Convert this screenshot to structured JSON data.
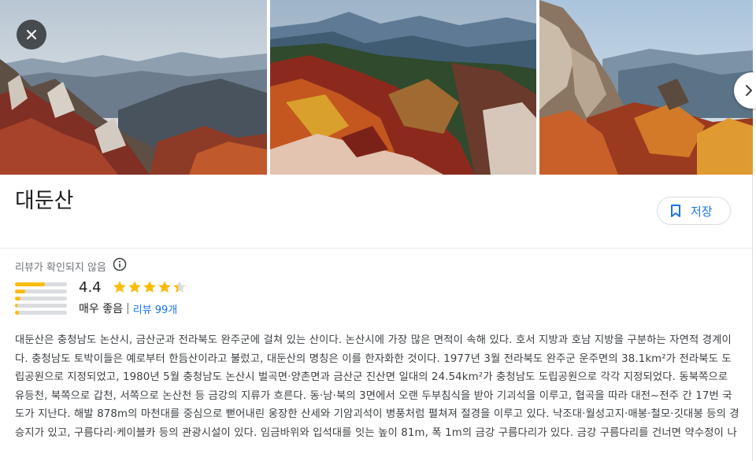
{
  "place": {
    "title": "대둔산",
    "save_label": "저장"
  },
  "photos": [
    {
      "icon": "mountain-mist-photo"
    },
    {
      "icon": "autumn-ridge-photo"
    },
    {
      "icon": "rocky-peak-photo"
    }
  ],
  "controls": {
    "close_icon": "close-icon",
    "next_icon": "chevron-right-icon",
    "save_icon": "bookmark-icon"
  },
  "rating": {
    "unverified_label": "리뷰가 확인되지 않음",
    "score": "4.4",
    "score_value": 4.4,
    "word": "매우 좋음",
    "separator": "|",
    "reviews_link": "리뷰 99개",
    "distribution": [
      0.58,
      0.2,
      0.1,
      0.05,
      0.08
    ]
  },
  "description": "대둔산은 충청남도 논산시, 금산군과 전라북도 완주군에 걸쳐 있는 산이다. 논산시에 가장 많은 면적이 속해 있다. 호서 지방과 호남 지방을 구분하는 자연적 경계이다. 충청남도 토박이들은 예로부터 한듬산이라고 불렀고, 대둔산의 명칭은 이를 한자화한 것이다. 1977년 3월 전라북도 완주군 운주면의 38.1km²가 전라북도 도립공원으로 지정되었고, 1980년 5월 충청남도 논산시 벌곡면·양촌면과 금산군 진산면 일대의 24.54km²가 충청남도 도립공원으로 각각 지정되었다. 동북쪽으로 유등천, 북쪽으로 갑천, 서쪽으로 논산천 등 금강의 지류가 흐른다. 동·남·북의 3면에서 오랜 두부침식을 받아 기괴석을 이루고, 협곡을 따라 대전~전주 간 17번 국도가 지난다. 해발 878m의 마천대를 중심으로 뻗어내린 웅장한 산세와 기암괴석이 병풍처럼 펼쳐져 절경을 이루고 있다. 낙조대·월성고지·매봉·철모·깃대봉 등의 경승지가 있고, 구름다리·케이블카 등의 관광시설이 있다. 임금바위와 입석대를 잇는 높이 81m, 폭 1m의 금강 구름다리가 있다. 금강 구름다리를 건너면 약수정이 나"
}
